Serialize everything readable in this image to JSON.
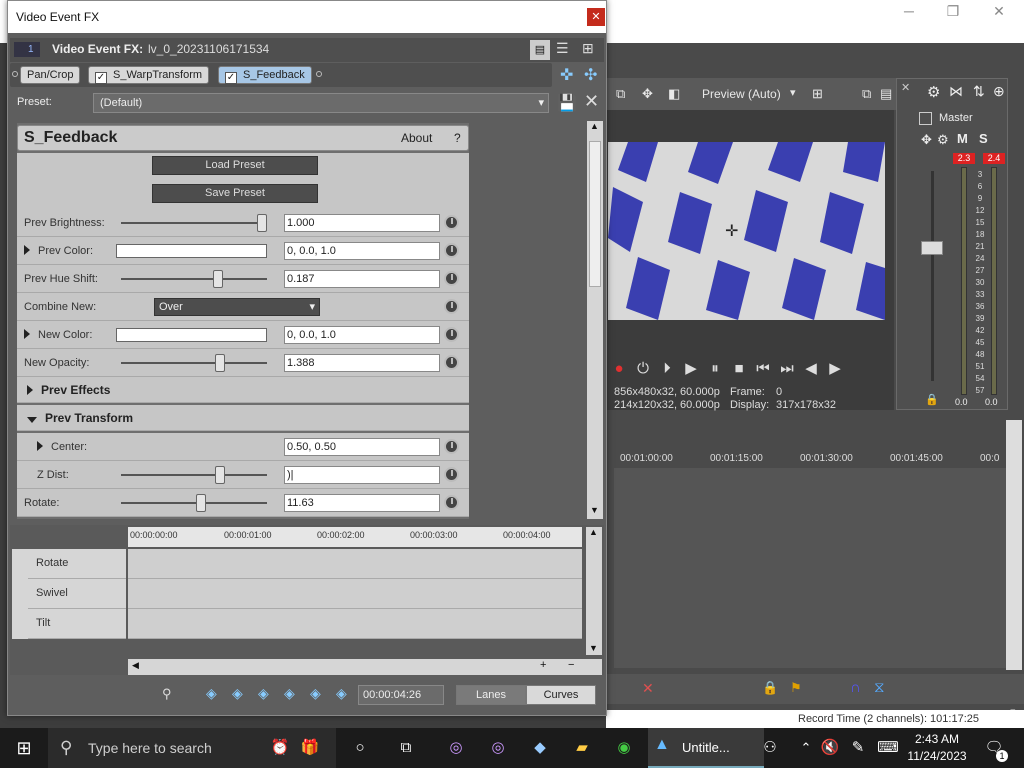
{
  "background_app": {
    "preview_toolbar": {
      "preview_mode": "Preview (Auto)"
    },
    "preview_info": {
      "project": "856x480x32, 60.000p",
      "preview": "214x120x32, 60.000p",
      "frame_label": "Frame:",
      "frame_value": "0",
      "display_label": "Display:",
      "display_value": "317x178x32"
    },
    "mixer": {
      "title": "Master",
      "peak_left": "2.3",
      "peak_right": "2.4",
      "scale": [
        "3",
        "6",
        "9",
        "12",
        "15",
        "18",
        "21",
        "24",
        "27",
        "30",
        "33",
        "36",
        "39",
        "42",
        "45",
        "48",
        "51",
        "54",
        "57"
      ],
      "level_left": "0.0",
      "level_right": "0.0"
    },
    "timeline_ruler": [
      "00:01:00:00",
      "00:01:15:00",
      "00:01:30:00",
      "00:01:45:00",
      "00:0"
    ],
    "status_text": "Record Time (2 channels): 101:17:25",
    "colors": {
      "bg": "#4a4a4a",
      "accent_red": "#e02020"
    }
  },
  "dialog": {
    "title": "Video Event FX",
    "header": {
      "track_num": "1",
      "label": "Video Event FX:",
      "event_name": "lv_0_20231106171534"
    },
    "fx_chain": [
      "Pan/Crop",
      "S_WarpTransform",
      "S_Feedback"
    ],
    "preset": {
      "label": "Preset:",
      "value": "(Default)"
    },
    "plugin": {
      "name": "S_Feedback",
      "about": "About",
      "help": "?",
      "load_preset": "Load Preset",
      "save_preset": "Save Preset",
      "params": {
        "prev_brightness": {
          "label": "Prev Brightness:",
          "value": "1.000",
          "level": 1.0
        },
        "prev_color": {
          "label": "Prev Color:",
          "value": "0, 0.0, 1.0"
        },
        "prev_hue_shift": {
          "label": "Prev Hue Shift:",
          "value": "0.187",
          "level": 0.68
        },
        "combine_new": {
          "label": "Combine New:",
          "value": "Over"
        },
        "new_color": {
          "label": "New Color:",
          "value": "0, 0.0, 1.0"
        },
        "new_opacity": {
          "label": "New Opacity:",
          "value": "1.388",
          "level": 0.69
        },
        "prev_effects": {
          "label": "Prev Effects"
        },
        "prev_transform": {
          "label": "Prev Transform"
        },
        "center": {
          "label": "Center:",
          "value": "0.50, 0.50"
        },
        "z_dist": {
          "label": "Z Dist:",
          "value": ")|",
          "level": 0.69
        },
        "rotate": {
          "label": "Rotate:",
          "value": "11.63",
          "level": 0.55
        }
      }
    },
    "keyframes": {
      "ruler": [
        "00:00:00:00",
        "00:00:01:00",
        "00:00:02:00",
        "00:00:03:00",
        "00:00:04:00"
      ],
      "tracks": [
        "Rotate",
        "Swivel",
        "Tilt"
      ]
    },
    "bottom": {
      "time": "00:00:04:26",
      "lanes": "Lanes",
      "curves": "Curves"
    }
  },
  "taskbar": {
    "search_placeholder": "Type here to search",
    "active_app": "Untitle...",
    "time": "2:43 AM",
    "date": "11/24/2023",
    "notif_count": "1"
  }
}
